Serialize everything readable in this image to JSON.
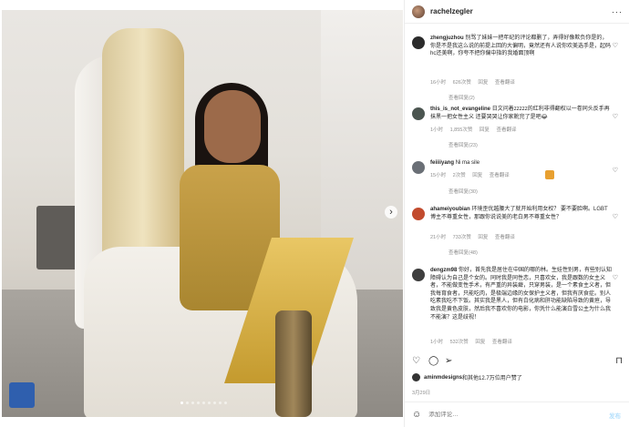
{
  "post": {
    "username": "rachelzegler",
    "more_label": "···"
  },
  "photo": {
    "next_label": "›",
    "dot_count": 9,
    "active_dot": 0
  },
  "comments": [
    {
      "user": "zhengjuzhou",
      "text": "别骂了妹妹一把年纪的评论都删了，弄得好像欺负你是的，你是不是我这么说的前提上回的大偏明，竟然还有人说你欢美选手是，起码hc还美啊，你夸不把你偏中指的我婚面顶啊",
      "time": "16小时",
      "likes": "626次赞",
      "reply": "回复",
      "translate": "查看翻译",
      "view_replies": "查看回复(2)"
    },
    {
      "user": "this_is_not_evangeline",
      "text": "日文问着zzzzz的红利非得翻权以一卷同头反手再抹黑一把女性主义 还要哭哭让你家靴完了是吧😂",
      "time": "1小时",
      "likes": "1,855次赞",
      "reply": "回复",
      "translate": "查看翻译",
      "view_replies": "查看回复(23)"
    },
    {
      "user": "feiiiiyang",
      "text": "Ni ma sile",
      "time": "15小时",
      "likes": "2次赞",
      "reply": "回复",
      "translate": "查看翻译",
      "view_replies": "查看回复(30)"
    },
    {
      "user": "ahameiyoubian",
      "text": "环境歪优越腰大了就开始利用女权？ 要不要脸啊。LGBT博主不尊重女性，那跟你说说美的老白男不尊重女性？",
      "time": "21小时",
      "likes": "733次赞",
      "reply": "回复",
      "translate": "查看翻译",
      "view_replies": "查看回复(48)"
    },
    {
      "user": "dengzm98",
      "text": "你好，首先我是居住在中国的哪的林。生娃性别男，有些别认知障碍认为自己是个女的。同时我是同性恋，只喜欢女，我是跟数的女主义者，不能做变性手术，有严重的异装癖，只穿男装，是一个素食主义者，但我每育食者，只能吃肉，是极端边缘的女保护主义者，但我有厌食症。别人吃素我吃不下饭。其实我是黑人，但有白化病和肝功能缺陷导致的黄疸，导致我是黄色皮肤，然后我不喜欢你的电影，你凭什么能演白雪公主为什么我不能演？这是歧视！",
      "time": "1小时",
      "likes": "532次赞",
      "reply": "回复",
      "translate": "查看翻译"
    }
  ],
  "actions": {
    "like_icon": "heart-icon",
    "comment_icon": "comment-icon",
    "share_icon": "share-icon",
    "save_icon": "bookmark-icon"
  },
  "likes_line": {
    "user": "aminmdesigns",
    "rest": "和其他12.7万位用户赞了"
  },
  "date": "3月29日",
  "add_comment": {
    "placeholder": "添加评论…",
    "post_label": "发布"
  },
  "colors": {
    "text": "#262626",
    "muted": "#8e8e8e",
    "link_disabled": "#b2dffc"
  }
}
